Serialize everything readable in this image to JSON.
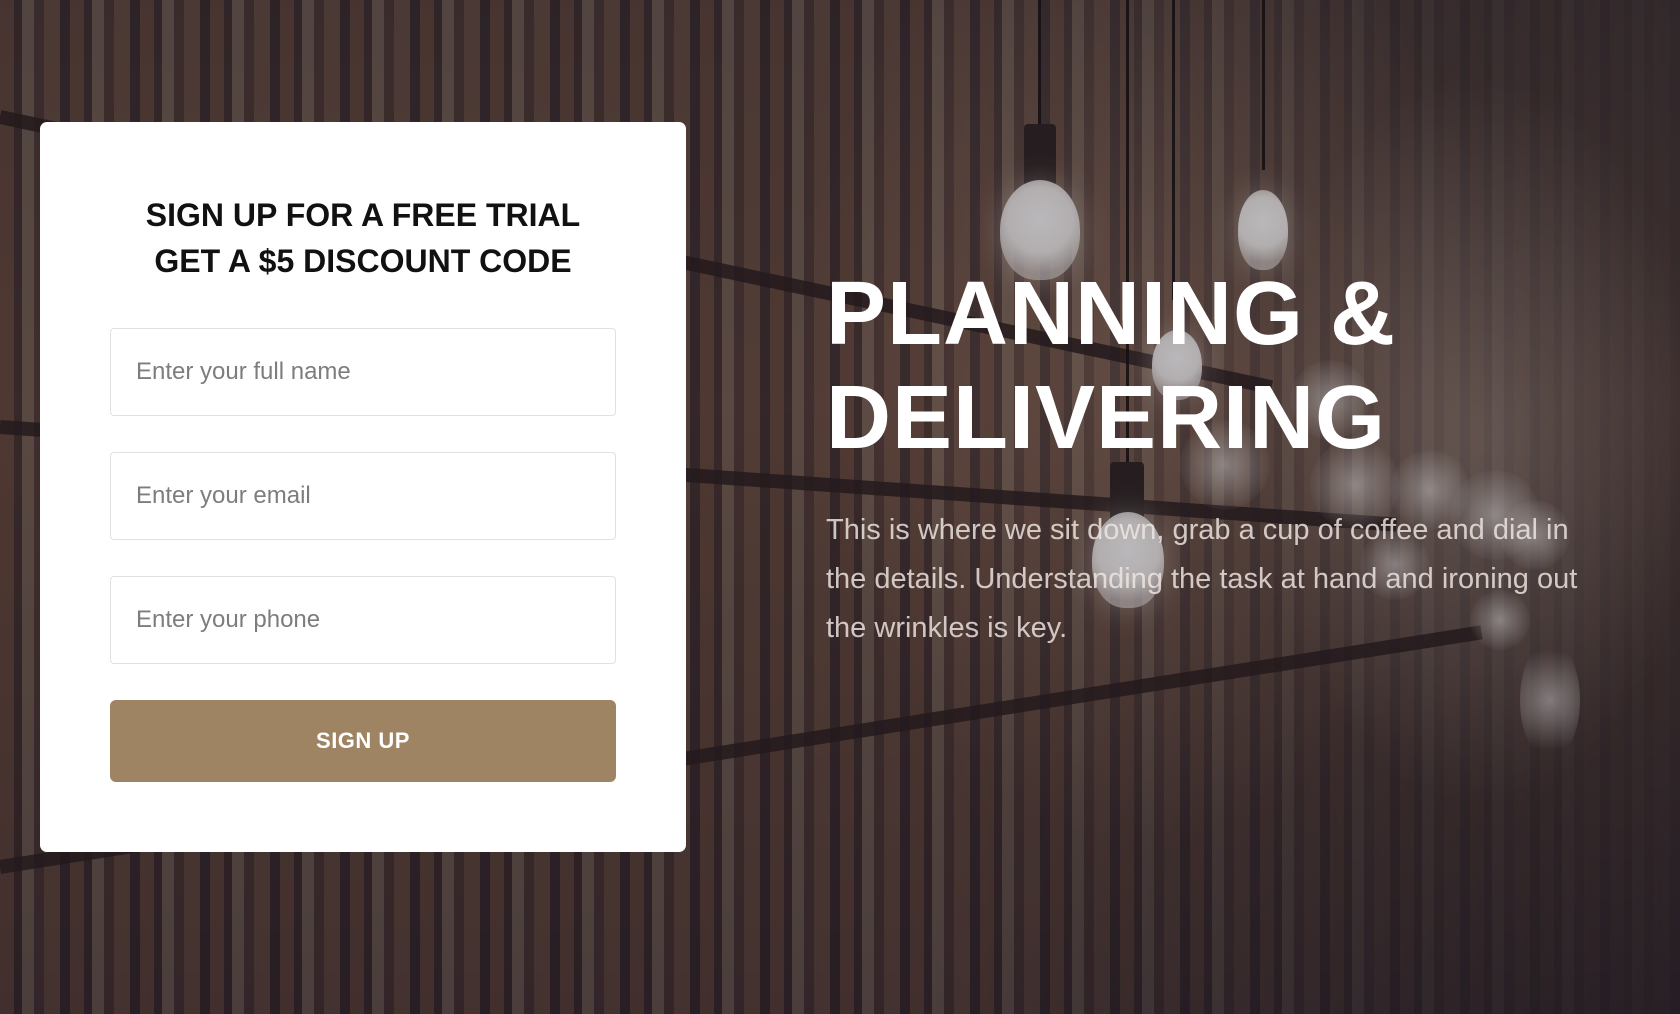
{
  "signup_card": {
    "title_line1": "SIGN UP FOR A FREE TRIAL",
    "title_line2": "GET A $5 DISCOUNT CODE",
    "name_placeholder": "Enter your full name",
    "email_placeholder": "Enter your email",
    "phone_placeholder": "Enter your phone",
    "submit_label": "SIGN UP"
  },
  "hero": {
    "title_line1": "PLANNING &",
    "title_line2": "DELIVERING",
    "description": "This is where we sit down, grab a cup of coffee and dial in the details. Understanding the task at hand and ironing out the wrinkles is key."
  },
  "colors": {
    "button": "#9e8463",
    "card": "#ffffff"
  }
}
